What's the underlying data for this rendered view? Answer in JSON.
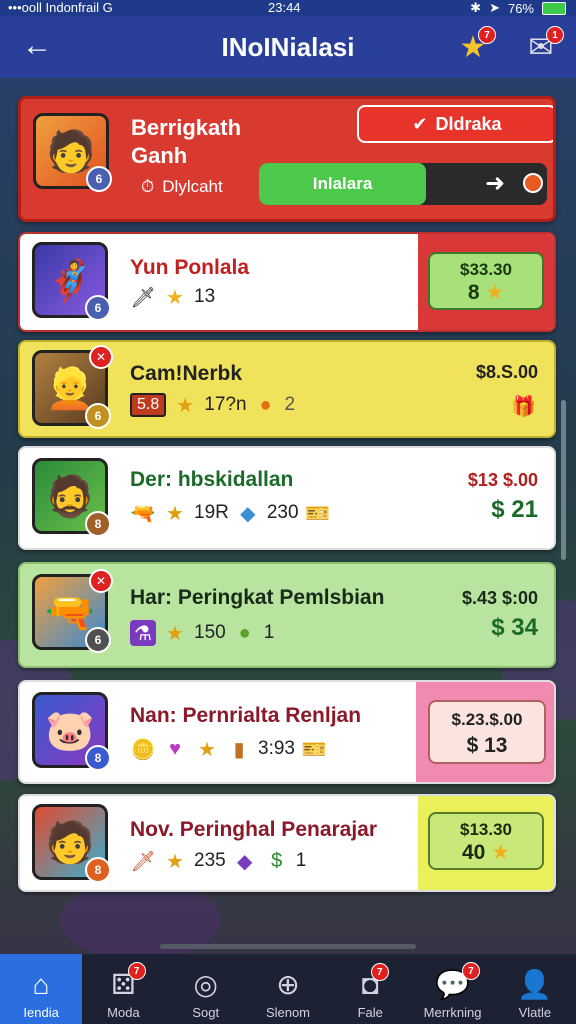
{
  "status_bar": {
    "carrier": "•••ooll Indonfrail G",
    "time": "23:44",
    "battery": "76%"
  },
  "header": {
    "title": "INoINialasi",
    "back_label": "←"
  },
  "featured": {
    "name_line1": "Berrigkath",
    "name_line2": "Ganh",
    "sub_label": "Dlylcaht",
    "button_label": "Dldraka",
    "progress_label": "Inlalara",
    "progress_fraction": 0.58,
    "badge_text": "6"
  },
  "rows": [
    {
      "name": "Yun Ponlala",
      "stat1": "13",
      "stat2": "",
      "stat3": "",
      "price1": "$33.30",
      "price2": "8",
      "badge": "6",
      "avatar_icon": "hero-blue",
      "theme": "red"
    },
    {
      "name": "Cam!Nerbk",
      "tag": "5.8",
      "stat1": "17?n",
      "stat2": "2",
      "stat3": "",
      "price1": "$8.S.00",
      "price2": "",
      "badge": "6",
      "avatar_icon": "hero-blonde",
      "theme": "yellow"
    },
    {
      "name": "Der: hbskidallan",
      "stat1": "19R",
      "stat2": "230",
      "stat3": "",
      "price1": "$13 $.00",
      "price2": "$ 21",
      "badge": "8",
      "avatar_icon": "hero-green",
      "theme": "white"
    },
    {
      "name": "Har: Peringkat Pemlsbian",
      "stat1": "150",
      "stat2": "1",
      "stat3": "",
      "price1": "$.43 $:00",
      "price2": "$ 34",
      "badge": "6",
      "avatar_icon": "item-blaster",
      "theme": "green"
    },
    {
      "name": "Nan: Pernrialta Renljan",
      "stat1": "3:93",
      "stat2": "",
      "stat3": "",
      "price1": "$.23.$.00",
      "price2": "$ 13",
      "badge": "8",
      "avatar_icon": "monster-pink",
      "theme": "pink"
    },
    {
      "name": "Nov. Peringhal Penarajar",
      "stat1": "235",
      "stat2": "1",
      "stat3": "",
      "price1": "$13.30",
      "price2": "40",
      "badge": "8",
      "avatar_icon": "hero-cyan",
      "theme": "lime"
    }
  ],
  "nav": [
    {
      "label": "Iendia",
      "icon": "home-icon",
      "badge": ""
    },
    {
      "label": "Moda",
      "icon": "dice-icon",
      "badge": "7"
    },
    {
      "label": "Sogt",
      "icon": "target-icon",
      "badge": ""
    },
    {
      "label": "Slenom",
      "icon": "compass-icon",
      "badge": ""
    },
    {
      "label": "Fale",
      "icon": "bag-icon",
      "badge": "7"
    },
    {
      "label": "Merrkning",
      "icon": "chat-icon",
      "badge": "7"
    },
    {
      "label": "Vlatle",
      "icon": "profile-icon",
      "badge": ""
    }
  ],
  "header_badges": {
    "star": "7",
    "mail": "1"
  }
}
